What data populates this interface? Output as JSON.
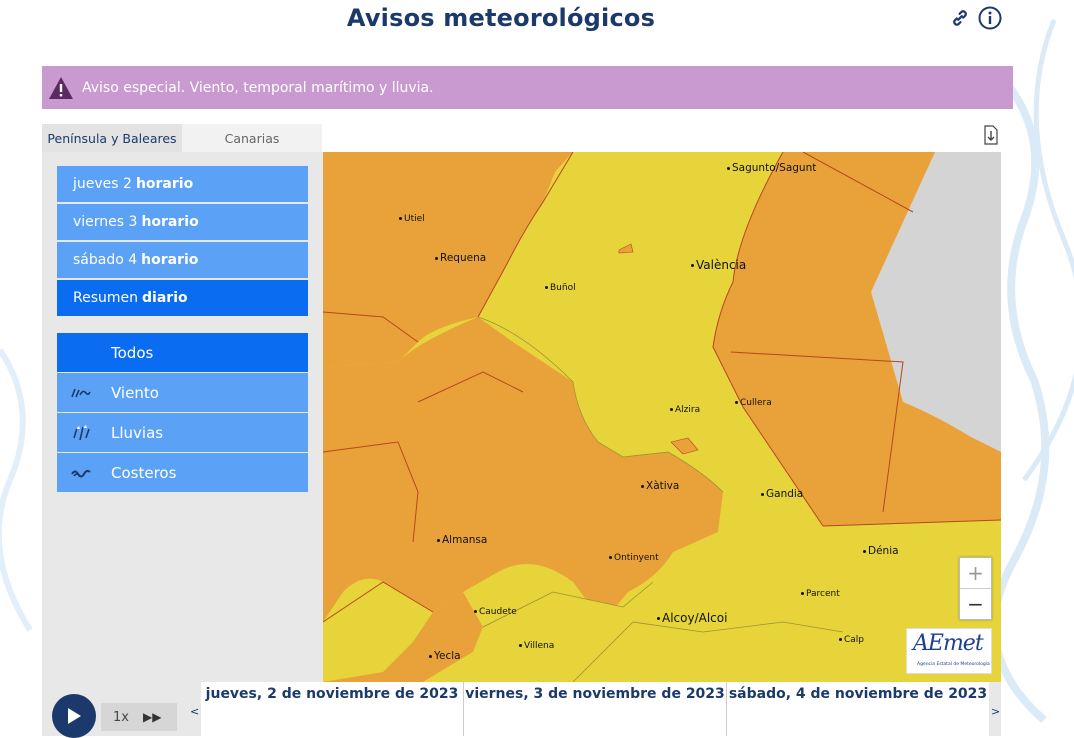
{
  "header": {
    "title": "Avisos meteorológicos"
  },
  "icons": {
    "link": "link-icon",
    "info": "info-icon"
  },
  "alert": {
    "text": "Aviso especial. Viento, temporal marítimo y lluvia.",
    "color": "#c99ad0"
  },
  "tabs": [
    {
      "label": "Península y Baleares",
      "active": true
    },
    {
      "label": "Canarias",
      "active": false
    }
  ],
  "days": [
    {
      "day": "jueves 2",
      "mode": "horario"
    },
    {
      "day": "viernes 3",
      "mode": "horario"
    },
    {
      "day": "sábado 4",
      "mode": "horario"
    },
    {
      "day": "Resumen",
      "mode": "diario",
      "selected": true
    }
  ],
  "filters": [
    {
      "label": "Todos",
      "selected": true
    },
    {
      "label": "Viento",
      "icon": "wind-icon"
    },
    {
      "label": "Lluvias",
      "icon": "rain-icon"
    },
    {
      "label": "Costeros",
      "icon": "waves-icon"
    }
  ],
  "map": {
    "colors": {
      "orange": "#e9a23a",
      "yellow": "#e6d43a",
      "sea": "#d4d4d4",
      "border": "#b8461f"
    },
    "cities": [
      "Sagunto/Sagunt",
      "Utiel",
      "Requena",
      "València",
      "Buñol",
      "Alzira",
      "Cullera",
      "Xàtiva",
      "Gandia",
      "Almansa",
      "Ontinyent",
      "Dénia",
      "Parcent",
      "Caudete",
      "Alcoy/Alcoi",
      "Villena",
      "Calp",
      "Yecla"
    ],
    "zoom_in": "+",
    "zoom_out": "−",
    "logo": "AEmet",
    "logo_sub": "Agencia Estatal de Meteorología"
  },
  "player": {
    "speed": "1x",
    "prev": "<",
    "next": ">"
  },
  "dates": [
    "jueves, 2 de noviembre de 2023",
    "viernes, 3 de noviembre de 2023",
    "sábado, 4 de noviembre de 2023"
  ]
}
